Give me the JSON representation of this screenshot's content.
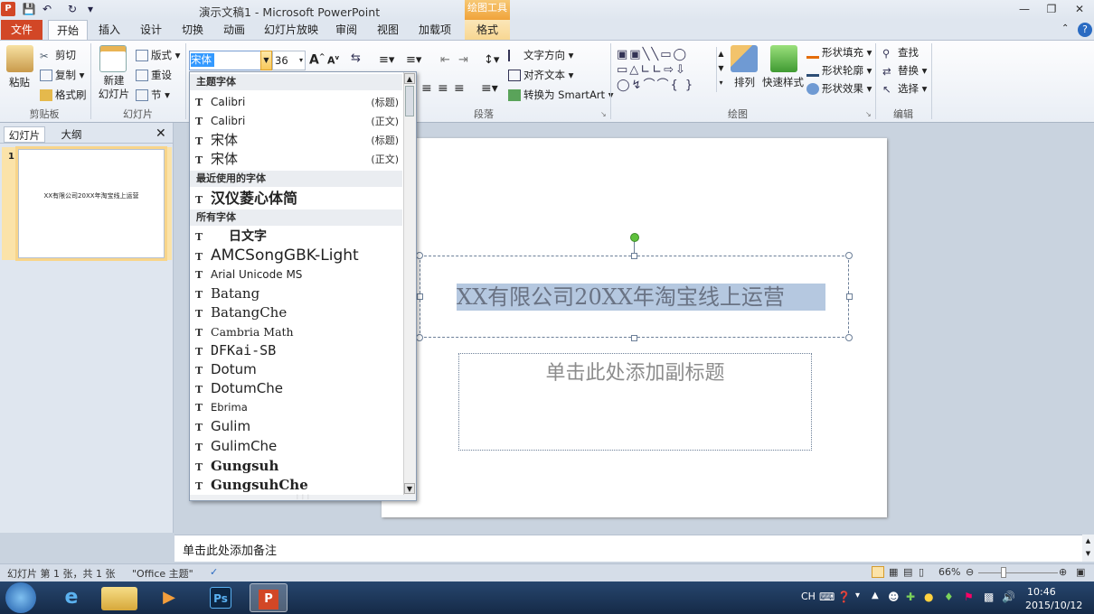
{
  "window": {
    "title": "演示文稿1 - Microsoft PowerPoint",
    "context_tab_header": "绘图工具",
    "app_icon": "P"
  },
  "tabs": [
    "文件",
    "开始",
    "插入",
    "设计",
    "切换",
    "动画",
    "幻灯片放映",
    "审阅",
    "视图",
    "加载项",
    "格式"
  ],
  "ribbon": {
    "clipboard": {
      "paste": "粘贴",
      "cut": "剪切",
      "copy": "复制",
      "format_painter": "格式刷",
      "label": "剪贴板"
    },
    "slides": {
      "new_slide": "新建\n幻灯片",
      "layout": "版式",
      "reset": "重设",
      "section": "节",
      "label": "幻灯片"
    },
    "font": {
      "name": "宋体",
      "size": "36"
    },
    "paragraph": {
      "text_direction": "文字方向",
      "align_text": "对齐文本",
      "smartart": "转换为 SmartArt",
      "label": "段落"
    },
    "drawing": {
      "arrange": "排列",
      "quick_styles": "快速样式",
      "shape_fill": "形状填充",
      "shape_outline": "形状轮廓",
      "shape_effects": "形状效果",
      "label": "绘图"
    },
    "editing": {
      "find": "查找",
      "replace": "替换",
      "select": "选择",
      "label": "编辑"
    }
  },
  "font_dropdown": {
    "theme_header": "主题字体",
    "theme_fonts": [
      {
        "name": "Calibri",
        "tag": "(标题)"
      },
      {
        "name": "Calibri",
        "tag": "(正文)"
      },
      {
        "name": "宋体",
        "tag": "(标题)"
      },
      {
        "name": "宋体",
        "tag": "(正文)"
      }
    ],
    "recent_header": "最近使用的字体",
    "recent_fonts": [
      "汉仪菱心体简"
    ],
    "all_header": "所有字体",
    "all_fonts": [
      "日文字",
      "AMCSongGBK-Light",
      "Arial Unicode MS",
      "Batang",
      "BatangChe",
      "Cambria Math",
      "DFKai-SB",
      "Dotum",
      "DotumChe",
      "Ebrima",
      "Gulim",
      "GulimChe",
      "Gungsuh",
      "GungsuhChe"
    ]
  },
  "left_pane": {
    "tab_slides": "幻灯片",
    "tab_outline": "大纲",
    "slide_number": "1",
    "thumb_title": "XX有限公司20XX年淘宝线上运营"
  },
  "slide": {
    "title": "XX有限公司20XX年淘宝线上运营",
    "subtitle_placeholder": "单击此处添加副标题"
  },
  "notes": {
    "placeholder": "单击此处添加备注"
  },
  "status": {
    "slide_info": "幻灯片 第 1 张，共 1 张",
    "theme": "\"Office 主题\"",
    "zoom": "66%"
  },
  "taskbar": {
    "ime": "CH",
    "time": "10:46",
    "date": "2015/10/12"
  },
  "colors": {
    "file_tab": "#d24726",
    "selection": "#3399ff",
    "context": "#f0a33a"
  }
}
